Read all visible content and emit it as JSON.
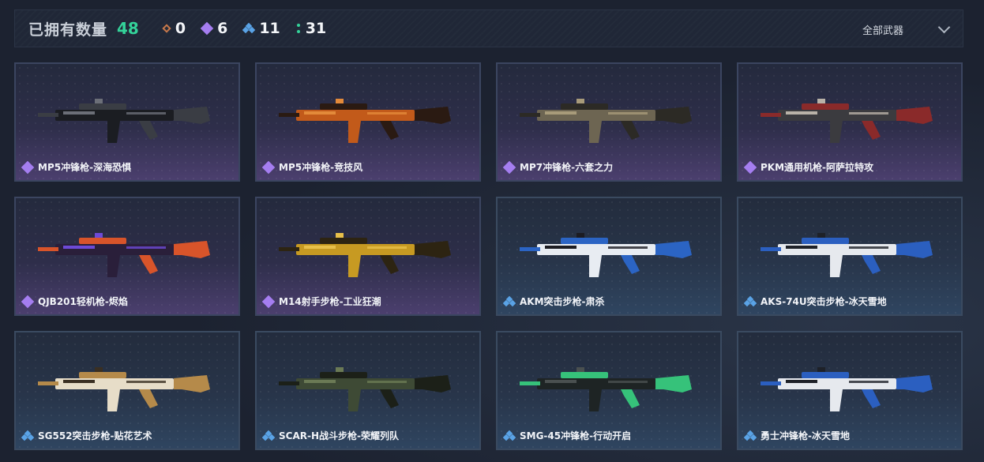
{
  "header": {
    "title": "已拥有数量",
    "total": "48",
    "stats": [
      {
        "rarity": "orange",
        "count": "0",
        "color": "#c9794a"
      },
      {
        "rarity": "purple",
        "count": "6",
        "color": "#a57ef0"
      },
      {
        "rarity": "blue",
        "count": "11",
        "color": "#5aa3e6"
      },
      {
        "rarity": "green",
        "count": "31",
        "color": "#34d39a"
      }
    ],
    "filter_label": "全部武器"
  },
  "cards": [
    {
      "name": "MP5冲锋枪-深海恐惧",
      "rarity": "purple"
    },
    {
      "name": "MP5冲锋枪-竞技风",
      "rarity": "purple"
    },
    {
      "name": "MP7冲锋枪-六套之力",
      "rarity": "purple"
    },
    {
      "name": "PKM通用机枪-阿萨拉特攻",
      "rarity": "purple"
    },
    {
      "name": "QJB201轻机枪-烬焰",
      "rarity": "purple"
    },
    {
      "name": "M14射手步枪-工业狂潮",
      "rarity": "purple"
    },
    {
      "name": "AKM突击步枪-肃杀",
      "rarity": "blue"
    },
    {
      "name": "AKS-74U突击步枪-冰天雪地",
      "rarity": "blue"
    },
    {
      "name": "SG552突击步枪-贴花艺术",
      "rarity": "blue"
    },
    {
      "name": "SCAR-H战斗步枪-荣耀列队",
      "rarity": "blue"
    },
    {
      "name": "SMG-45冲锋枪-行动开启",
      "rarity": "blue"
    },
    {
      "name": "勇士冲锋枪-冰天雪地",
      "rarity": "blue"
    }
  ]
}
